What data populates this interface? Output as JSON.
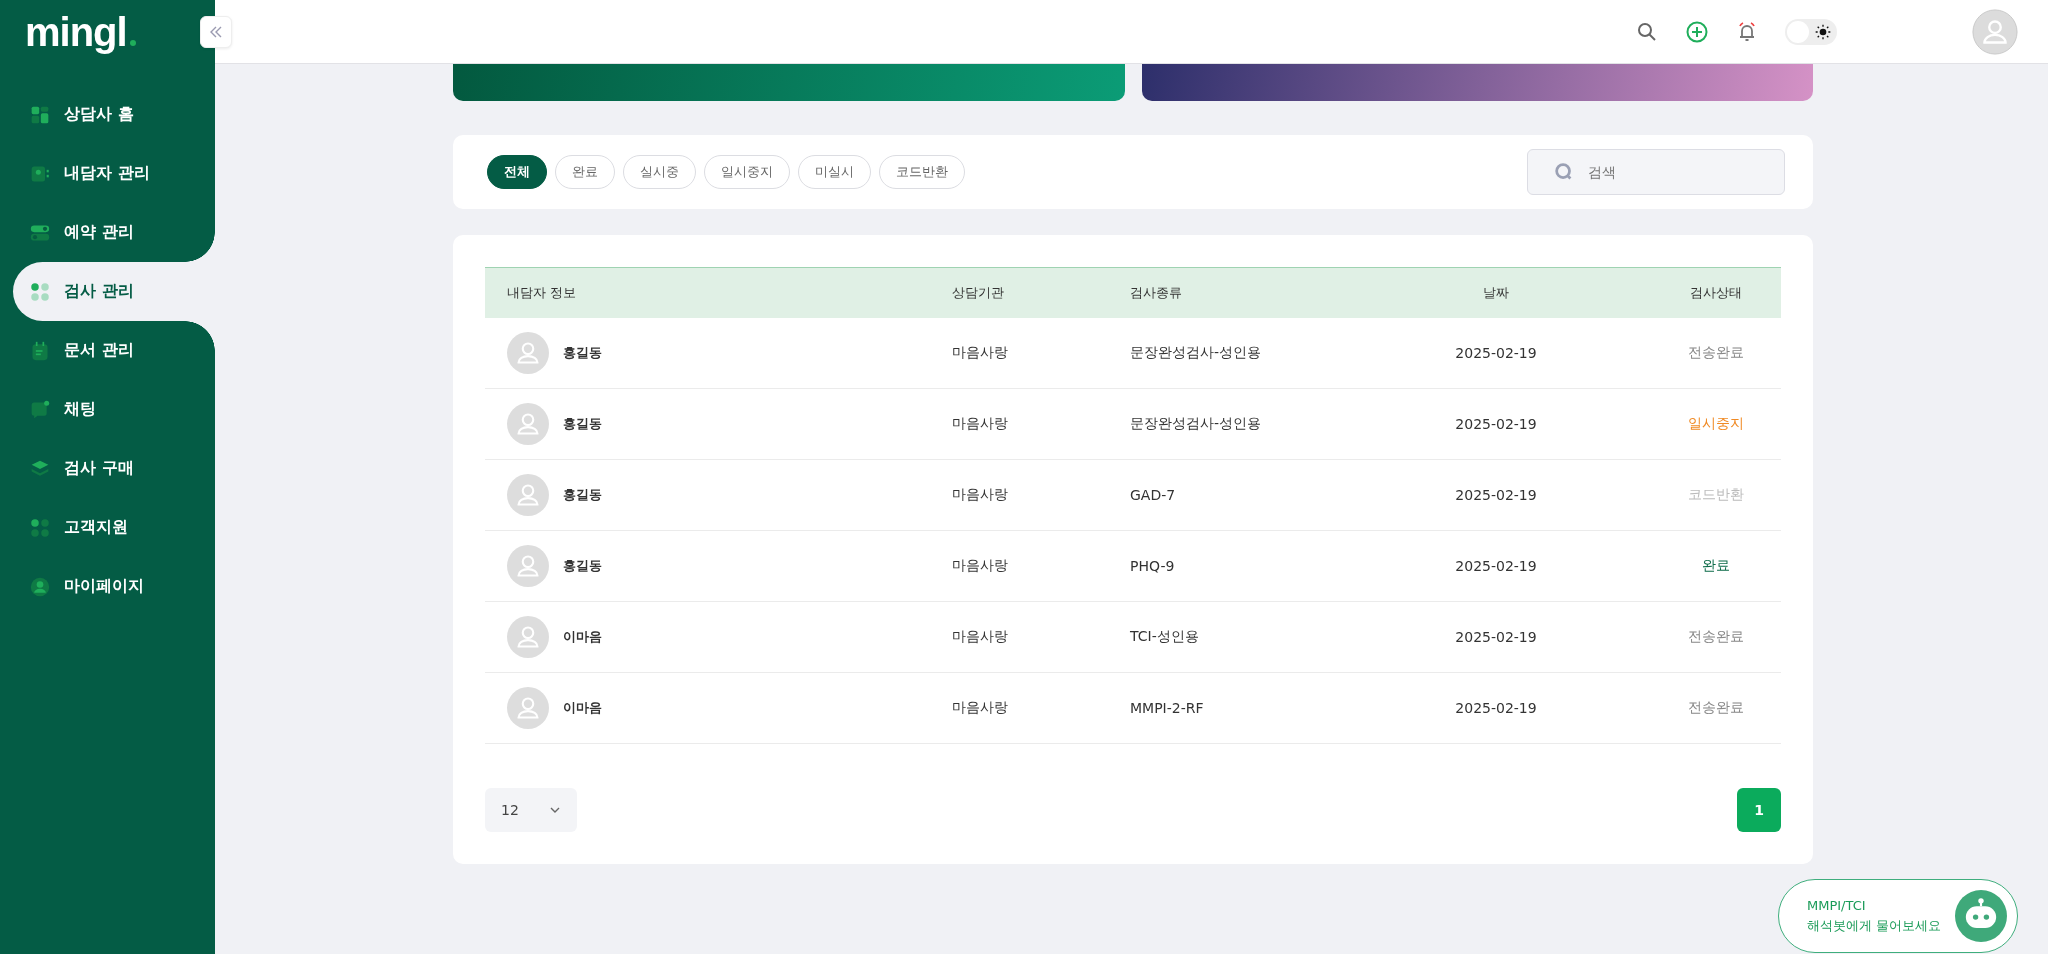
{
  "sidebar": {
    "logo": "mingl",
    "items": [
      {
        "label": "상담사 홈",
        "selected": false
      },
      {
        "label": "내담자 관리",
        "selected": false
      },
      {
        "label": "예약 관리",
        "selected": false
      },
      {
        "label": "검사 관리",
        "selected": true
      },
      {
        "label": "문서 관리",
        "selected": false
      },
      {
        "label": "채팅",
        "selected": false
      },
      {
        "label": "검사 구매",
        "selected": false
      },
      {
        "label": "고객지원",
        "selected": false
      },
      {
        "label": "마이페이지",
        "selected": false
      }
    ]
  },
  "header": {
    "theme_toggle": {
      "on": false
    }
  },
  "filters": [
    {
      "label": "전체",
      "selected": true
    },
    {
      "label": "완료",
      "selected": false
    },
    {
      "label": "실시중",
      "selected": false
    },
    {
      "label": "일시중지",
      "selected": false
    },
    {
      "label": "미실시",
      "selected": false
    },
    {
      "label": "코드반환",
      "selected": false
    }
  ],
  "search": {
    "placeholder": "검색"
  },
  "table": {
    "columns": [
      "내담자 정보",
      "상담기관",
      "검사종류",
      "날짜",
      "검사상태"
    ],
    "rows": [
      {
        "name": "홍길동",
        "agency": "마음사랑",
        "test": "문장완성검사-성인용",
        "date": "2025-02-19",
        "status": "전송완료",
        "color": "#888888"
      },
      {
        "name": "홍길동",
        "agency": "마음사랑",
        "test": "문장완성검사-성인용",
        "date": "2025-02-19",
        "status": "일시중지",
        "color": "#f08a24"
      },
      {
        "name": "홍길동",
        "agency": "마음사랑",
        "test": "GAD-7",
        "date": "2025-02-19",
        "status": "코드반환",
        "color": "#bbbbbb"
      },
      {
        "name": "홍길동",
        "agency": "마음사랑",
        "test": "PHQ-9",
        "date": "2025-02-19",
        "status": "완료",
        "color": "#0d6b49"
      },
      {
        "name": "이마음",
        "agency": "마음사랑",
        "test": "TCI-성인용",
        "date": "2025-02-19",
        "status": "전송완료",
        "color": "#888888"
      },
      {
        "name": "이마음",
        "agency": "마음사랑",
        "test": "MMPI-2-RF",
        "date": "2025-02-19",
        "status": "전송완료",
        "color": "#888888"
      }
    ]
  },
  "page_size": "12",
  "pages": [
    {
      "label": "1",
      "selected": true
    }
  ],
  "chatbot": {
    "title": "MMPI/TCI",
    "subtitle": "해석봇에게 물어보세요"
  }
}
